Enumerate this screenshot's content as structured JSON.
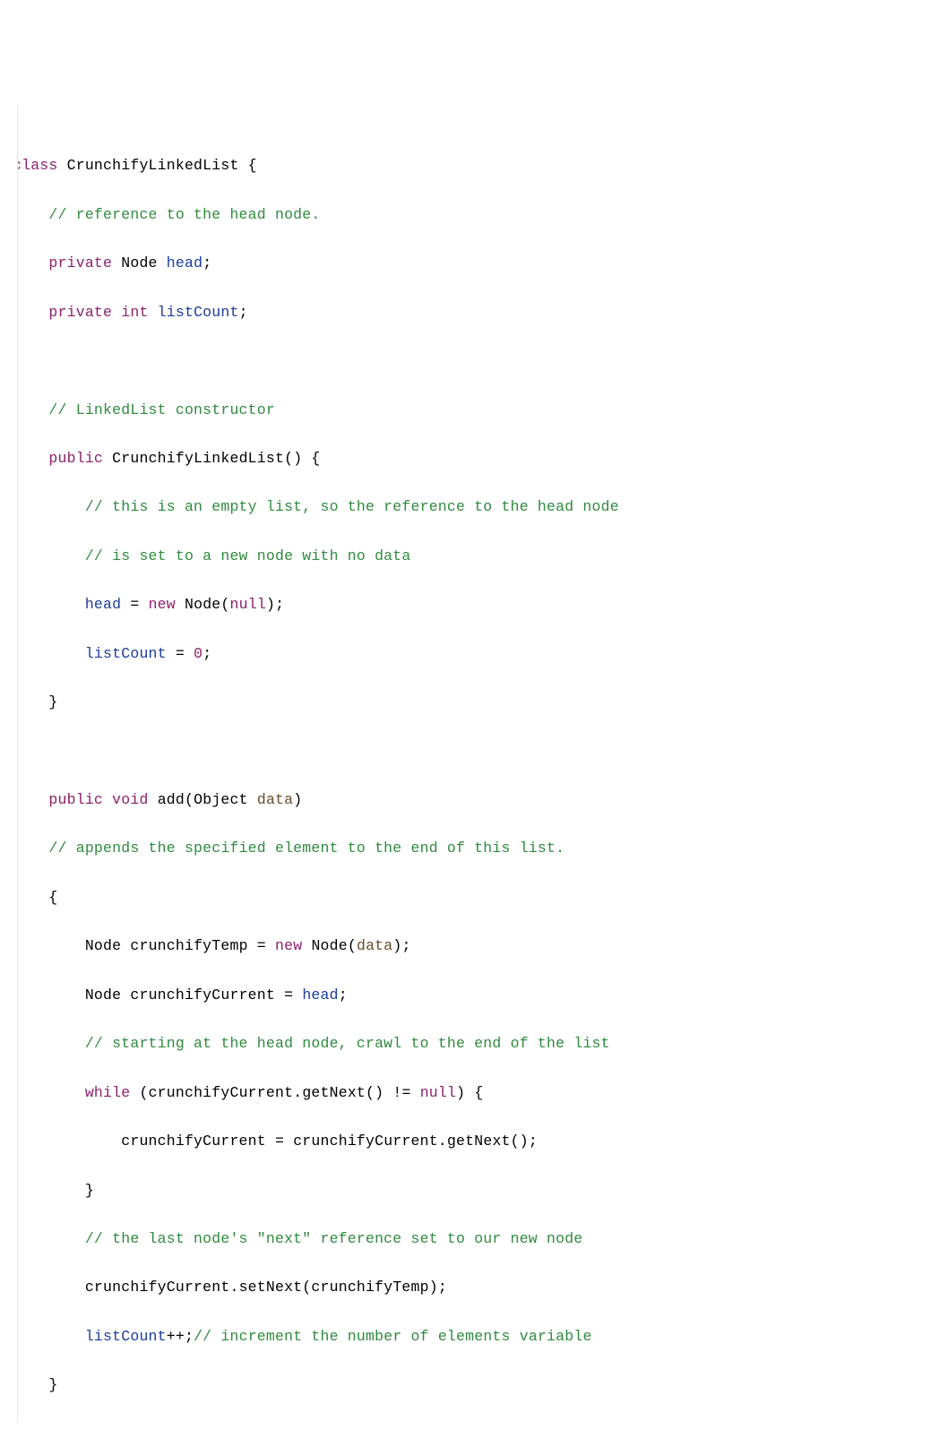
{
  "code": {
    "l1": {
      "kw_class": "class",
      "ty": "CrunchifyLinkedList",
      "brace": "{"
    },
    "l2": {
      "cm": "// reference to the head node."
    },
    "l3": {
      "kw_priv": "private",
      "ty": "Node",
      "fld": "head",
      "semi": ";"
    },
    "l4": {
      "kw_priv": "private",
      "kw_int": "int",
      "fld": "listCount",
      "semi": ";"
    },
    "l5": "",
    "l6": {
      "cm": "// LinkedList constructor"
    },
    "l7": {
      "kw_pub": "public",
      "ty": "CrunchifyLinkedList",
      "paren": "()",
      "brace": "{"
    },
    "l8": {
      "cm": "// this is an empty list, so the reference to the head node"
    },
    "l9": {
      "cm": "// is set to a new node with no data"
    },
    "l10": {
      "fld": "head",
      "eq": "=",
      "kw_new": "new",
      "ty": "Node",
      "lp": "(",
      "lit": "null",
      "rp": ")",
      "semi": ";"
    },
    "l11": {
      "fld": "listCount",
      "eq": "=",
      "lit": "0",
      "semi": ";"
    },
    "l12": {
      "brace": "}"
    },
    "l13": "",
    "l14": {
      "kw_pub": "public",
      "kw_void": "void",
      "mth": "add",
      "lp": "(",
      "ty": "Object",
      "prm": "data",
      "rp": ")"
    },
    "l15": {
      "cm": "// appends the specified element to the end of this list."
    },
    "l16": {
      "brace": "{"
    },
    "l17": {
      "ty1": "Node",
      "var": "crunchifyTemp",
      "eq": "=",
      "kw_new": "new",
      "ty2": "Node",
      "lp": "(",
      "prm": "data",
      "rp": ")",
      "semi": ";"
    },
    "l18": {
      "ty": "Node",
      "var": "crunchifyCurrent",
      "eq": "=",
      "fld": "head",
      "semi": ";"
    },
    "l19": {
      "cm": "// starting at the head node, crawl to the end of the list"
    },
    "l20": {
      "kw_while": "while",
      "lp": "(",
      "var": "crunchifyCurrent",
      "dot": ".",
      "mth": "getNext",
      "paren": "()",
      "neq": "!=",
      "lit": "null",
      "rp": ")",
      "brace": "{"
    },
    "l21": {
      "var1": "crunchifyCurrent",
      "eq": "=",
      "var2": "crunchifyCurrent",
      "dot": ".",
      "mth": "getNext",
      "paren": "()",
      "semi": ";"
    },
    "l22": {
      "brace": "}"
    },
    "l23": {
      "cm": "// the last node's \"next\" reference set to our new node"
    },
    "l24": {
      "var": "crunchifyCurrent",
      "dot": ".",
      "mth": "setNext",
      "lp": "(",
      "arg": "crunchifyTemp",
      "rp": ")",
      "semi": ";"
    },
    "l25": {
      "fld": "listCount",
      "op": "++",
      "semi": ";",
      "cm": "// increment the number of elements variable"
    },
    "l26": {
      "brace": "}"
    }
  }
}
